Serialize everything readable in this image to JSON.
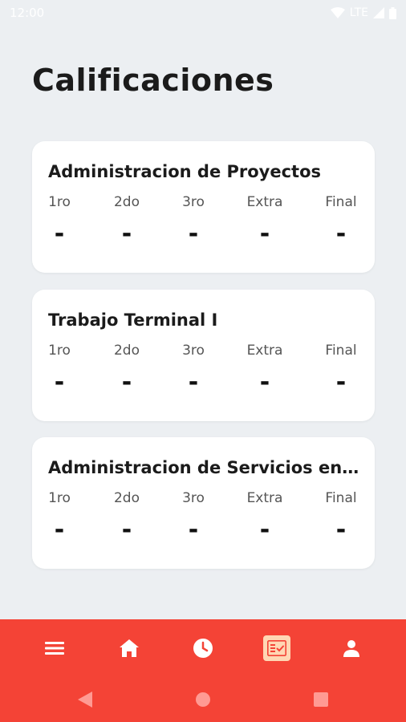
{
  "status_bar": {
    "time": "12:00",
    "network": "LTE"
  },
  "page": {
    "title": "Calificaciones"
  },
  "grade_labels": [
    "1ro",
    "2do",
    "3ro",
    "Extra",
    "Final"
  ],
  "courses": [
    {
      "name": "Administracion de Proyectos",
      "grades": [
        "-",
        "-",
        "-",
        "-",
        "-"
      ]
    },
    {
      "name": "Trabajo Terminal I",
      "grades": [
        "-",
        "-",
        "-",
        "-",
        "-"
      ]
    },
    {
      "name": "Administracion de Servicios en ...",
      "grades": [
        "-",
        "-",
        "-",
        "-",
        "-"
      ]
    }
  ],
  "bottom_nav": {
    "items": [
      {
        "icon": "menu-icon"
      },
      {
        "icon": "home-icon"
      },
      {
        "icon": "clock-icon"
      },
      {
        "icon": "grades-icon",
        "active": true
      },
      {
        "icon": "profile-icon"
      }
    ]
  },
  "colors": {
    "accent": "#f44336",
    "active_tab_bg": "#ffd7b4",
    "background": "#eceff2"
  }
}
